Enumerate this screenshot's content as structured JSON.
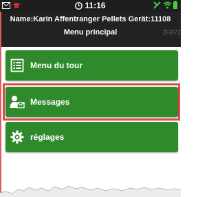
{
  "statusbar": {
    "time": "11:16",
    "left_icons": [
      "mail-icon",
      "cap-icon"
    ],
    "right_icons": [
      "no-sim-icon",
      "wifi-icon",
      "battery-icon"
    ]
  },
  "header": {
    "name_line": "Name:Karin Affentranger Pellets Gerät:11108",
    "title": "Menu principal",
    "code": "2FB72"
  },
  "menu": [
    {
      "label": "Menu du tour",
      "icon": "list-icon"
    },
    {
      "label": "Messages",
      "icon": "user-mail-icon"
    },
    {
      "label": "réglages",
      "icon": "gear-icon"
    }
  ],
  "colors": {
    "button_green": "#2f8a2c",
    "header_bg": "#222222",
    "highlight": "#e04b4b"
  }
}
